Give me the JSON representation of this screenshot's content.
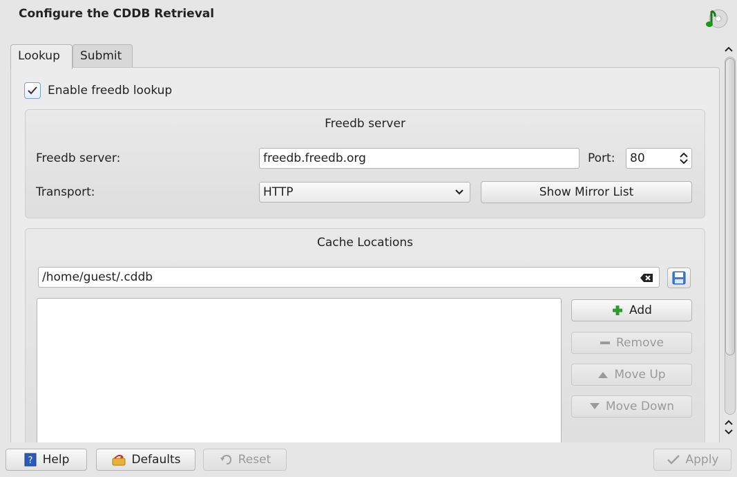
{
  "window": {
    "title": "Configure the CDDB Retrieval",
    "icon": "music-note-cd-icon"
  },
  "tabs": [
    {
      "label": "Lookup",
      "mnemonic": "L",
      "active": true
    },
    {
      "label": "Submit",
      "mnemonic": "S",
      "active": false
    }
  ],
  "lookup": {
    "enable_checkbox": {
      "label": "Enable freedb lookup",
      "checked": true
    }
  },
  "freedb_server": {
    "group_title": "Freedb server",
    "server_label": "Freedb server:",
    "server_value": "freedb.freedb.org",
    "port_label": "Port:",
    "port_value": "80",
    "transport_label": "Transport:",
    "transport_value": "HTTP",
    "mirror_button": "Show Mirror List"
  },
  "cache": {
    "group_title": "Cache Locations",
    "path_value": "/home/guest/.cddb",
    "buttons": {
      "add": "Add",
      "remove": "Remove",
      "move_up": "Move Up",
      "move_down": "Move Down"
    }
  },
  "footer": {
    "help": "Help",
    "defaults": "Defaults",
    "reset": "Reset",
    "apply": "Apply"
  }
}
